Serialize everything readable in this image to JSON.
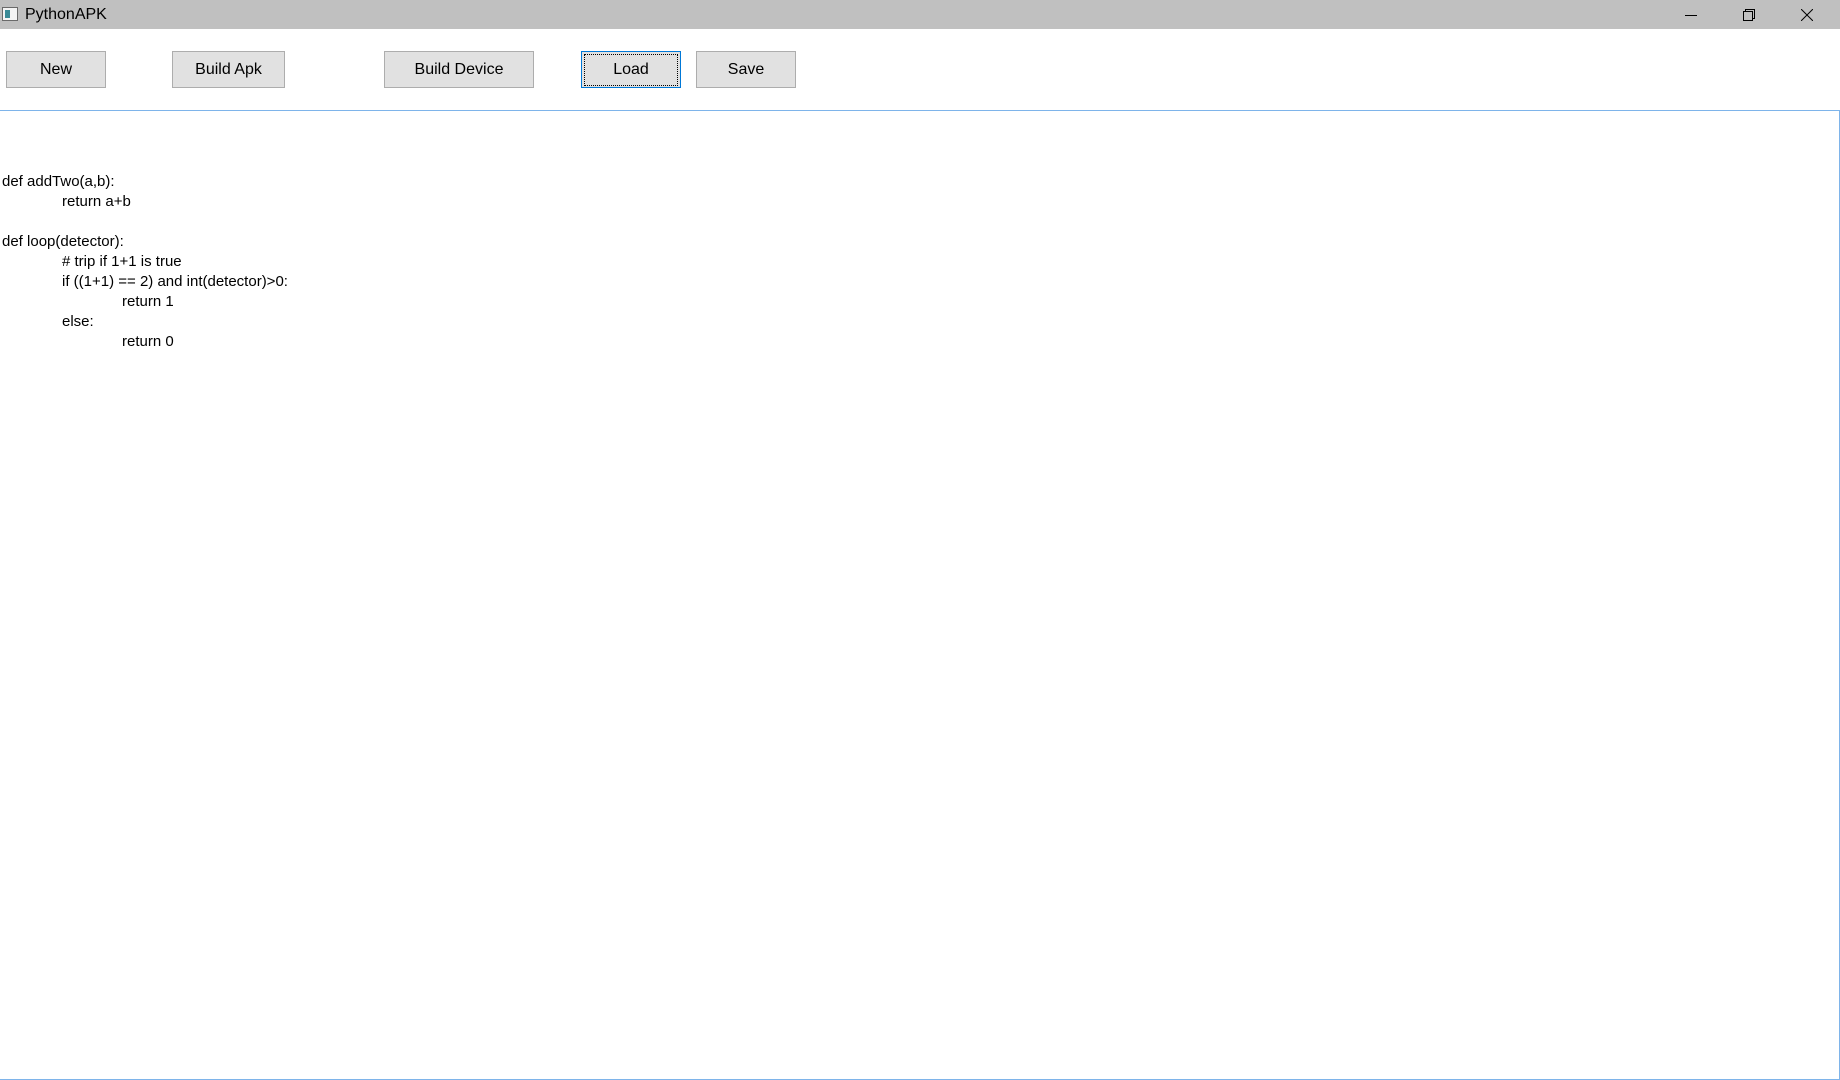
{
  "window": {
    "title": "PythonAPK",
    "icons": {
      "app": "app-window-icon",
      "minimize": "minimize-icon",
      "restore": "restore-icon",
      "close": "close-icon"
    }
  },
  "toolbar": {
    "new_label": "New",
    "build_apk_label": "Build Apk",
    "build_device_label": "Build Device",
    "load_label": "Load",
    "save_label": "Save",
    "focused_button": "Load"
  },
  "editor": {
    "lines": [
      "",
      "def addTwo(a,b):",
      "return a+b",
      "",
      "def loop(detector):",
      "# trip if 1+1 is true",
      "if ((1+1) == 2) and int(detector)>0:",
      "return 1",
      "else:",
      "return 0"
    ]
  },
  "colors": {
    "titlebar_bg": "#c0c0c0",
    "button_bg": "#e1e1e1",
    "button_border": "#adadad",
    "focus_border": "#0078d7",
    "editor_border": "#7eb4ea"
  }
}
